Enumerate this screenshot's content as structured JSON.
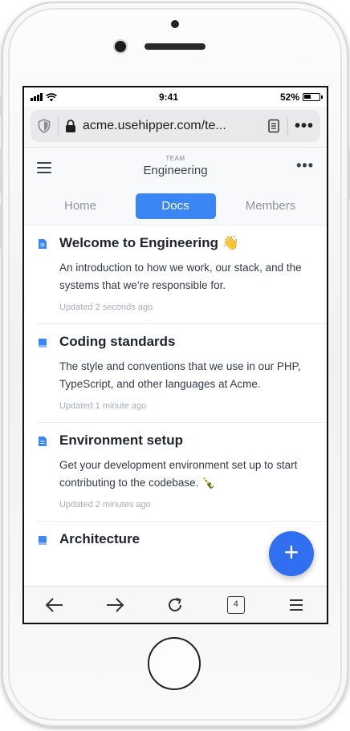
{
  "status_bar": {
    "time": "9:41",
    "battery": "52%",
    "battery_level": 0.52
  },
  "browser": {
    "url": "acme.usehipper.com/te..."
  },
  "header": {
    "team_label": "TEAM",
    "team_name": "Engineering"
  },
  "tabs": [
    {
      "label": "Home",
      "active": false
    },
    {
      "label": "Docs",
      "active": true
    },
    {
      "label": "Members",
      "active": false
    }
  ],
  "docs": [
    {
      "title": "Welcome to Engineering 👋",
      "description": "An introduction to how we work, our stack, and the systems that we’re responsible for.",
      "updated": "Updated 2 seconds ago"
    },
    {
      "title": "Coding standards",
      "description": "The style and conventions that we use in our PHP, TypeScript, and other languages at Acme.",
      "updated": "Updated 1 minute ago"
    },
    {
      "title": "Environment setup",
      "description": "Get your development environment set up to start contributing to the codebase. 🍾",
      "updated": "Updated 2 minutes ago"
    },
    {
      "title": "Architecture",
      "description": "",
      "updated": ""
    }
  ],
  "fab": {
    "label": "+"
  },
  "toolbar": {
    "tab_count": "4"
  },
  "colors": {
    "accent": "#3b86f5",
    "fab": "#2f6ff0",
    "title": "#1d2330"
  }
}
